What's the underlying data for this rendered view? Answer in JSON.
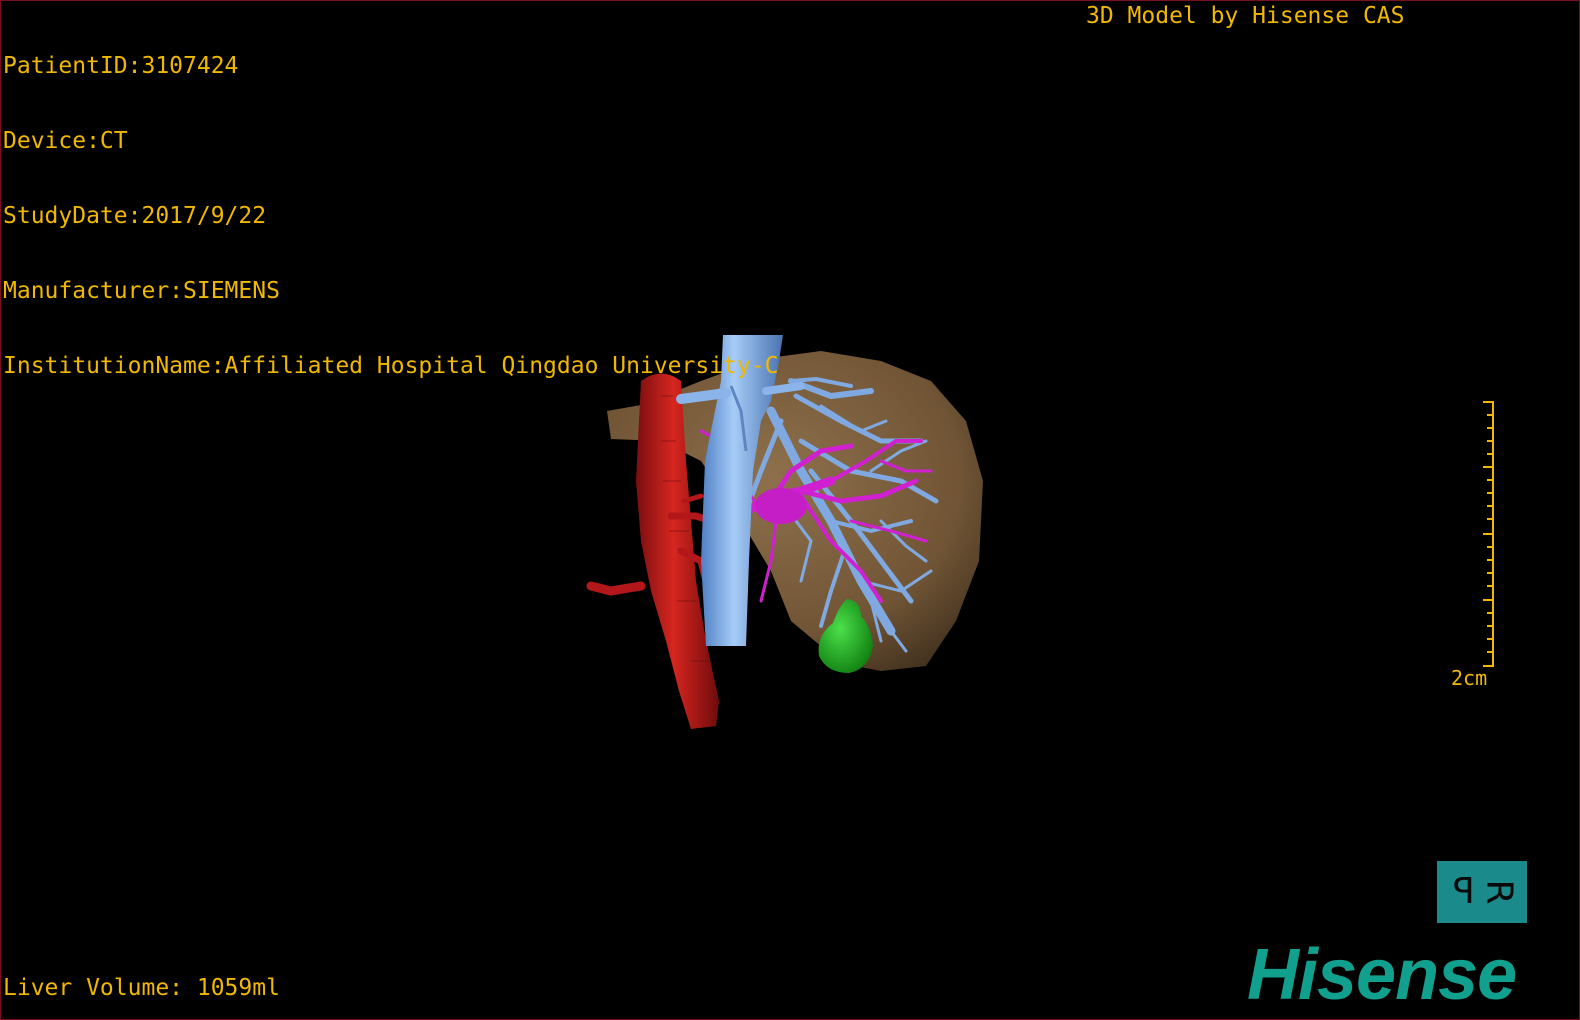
{
  "info": {
    "patient_id": "PatientID:3107424",
    "device": "Device:CT",
    "study_date": "StudyDate:2017/9/22",
    "manufacturer": "Manufacturer:SIEMENS",
    "institution": "InstitutionName:Affiliated Hospital Qingdao University-C"
  },
  "model_credit": "3D Model by Hisense CAS",
  "scale": {
    "label": "2cm"
  },
  "liver_volume": "Liver Volume: 1059ml",
  "orientation": {
    "left": "P",
    "right": "R"
  },
  "logo": "Hisense",
  "colors": {
    "overlay_text": "#f0b800",
    "liver": "#7a5c3a",
    "aorta": "#c0191c",
    "vena_cava": "#7fb3ee",
    "portal_vein": "#d020d0",
    "gallbladder": "#1fb81f",
    "logo": "#12a08e",
    "orientation_cube": "#1b8a8a",
    "border": "#7a1020"
  },
  "icons": {
    "orientation": "orientation-cube-icon",
    "scale": "scale-ruler-icon"
  }
}
